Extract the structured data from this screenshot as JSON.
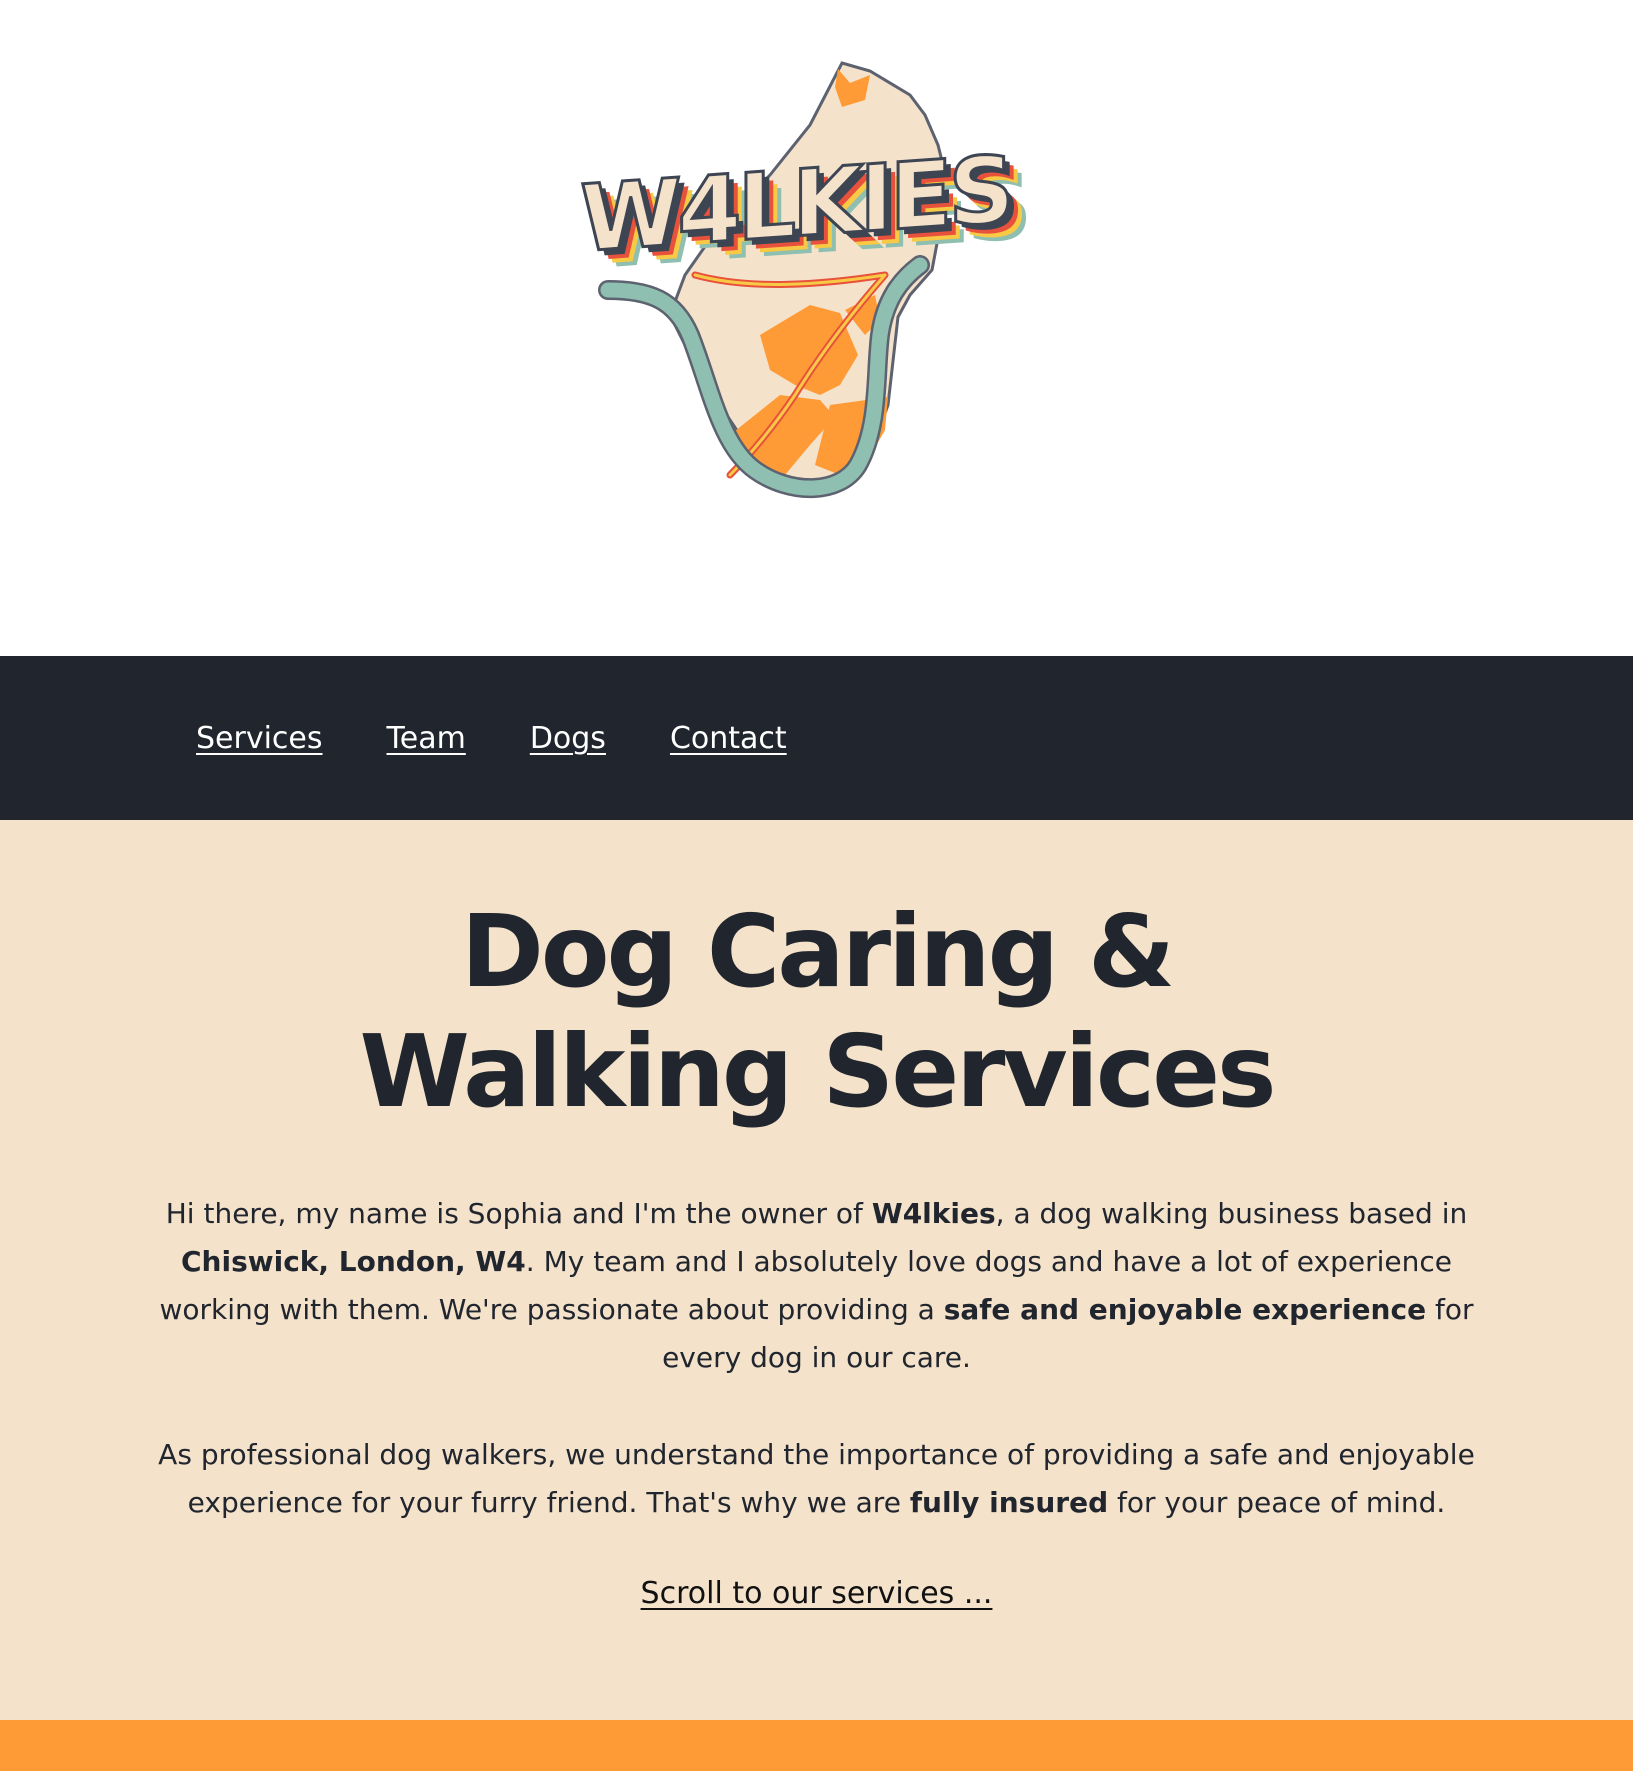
{
  "logo": {
    "wordmark": "W4LKIES",
    "icon": "w4-map-logo",
    "colors": {
      "cream": "#f4e2cb",
      "orange": "#ff9b36",
      "teal": "#8fbfb0",
      "outline": "#5d6270",
      "red": "#e8513c",
      "yellow": "#f7c945",
      "dark": "#3d4452"
    }
  },
  "nav": {
    "items": [
      {
        "label": "Services"
      },
      {
        "label": "Team"
      },
      {
        "label": "Dogs"
      },
      {
        "label": "Contact"
      }
    ],
    "background": "#21262e"
  },
  "hero": {
    "title": "Dog Caring & Walking Services",
    "background": "#f4e2cb",
    "paragraph1": {
      "t1": "Hi there, my name is Sophia and I'm the owner of ",
      "b1": "W4lkies",
      "t2": ", a dog walking business based in ",
      "b2": "Chiswick, London, W4",
      "t3": ". My team and I absolutely love dogs and have a lot of experience working with them. We're passionate about providing a ",
      "b3": "safe and enjoyable experience",
      "t4": " for every dog in our care."
    },
    "paragraph2": {
      "t1": "As professional dog walkers, we understand the importance of providing a safe and enjoyable experience for your furry friend. That's why we are ",
      "b1": "fully insured",
      "t2": " for your peace of mind."
    },
    "scroll_link": "Scroll to our services ..."
  },
  "footer_band": {
    "color": "#ff9b36"
  }
}
